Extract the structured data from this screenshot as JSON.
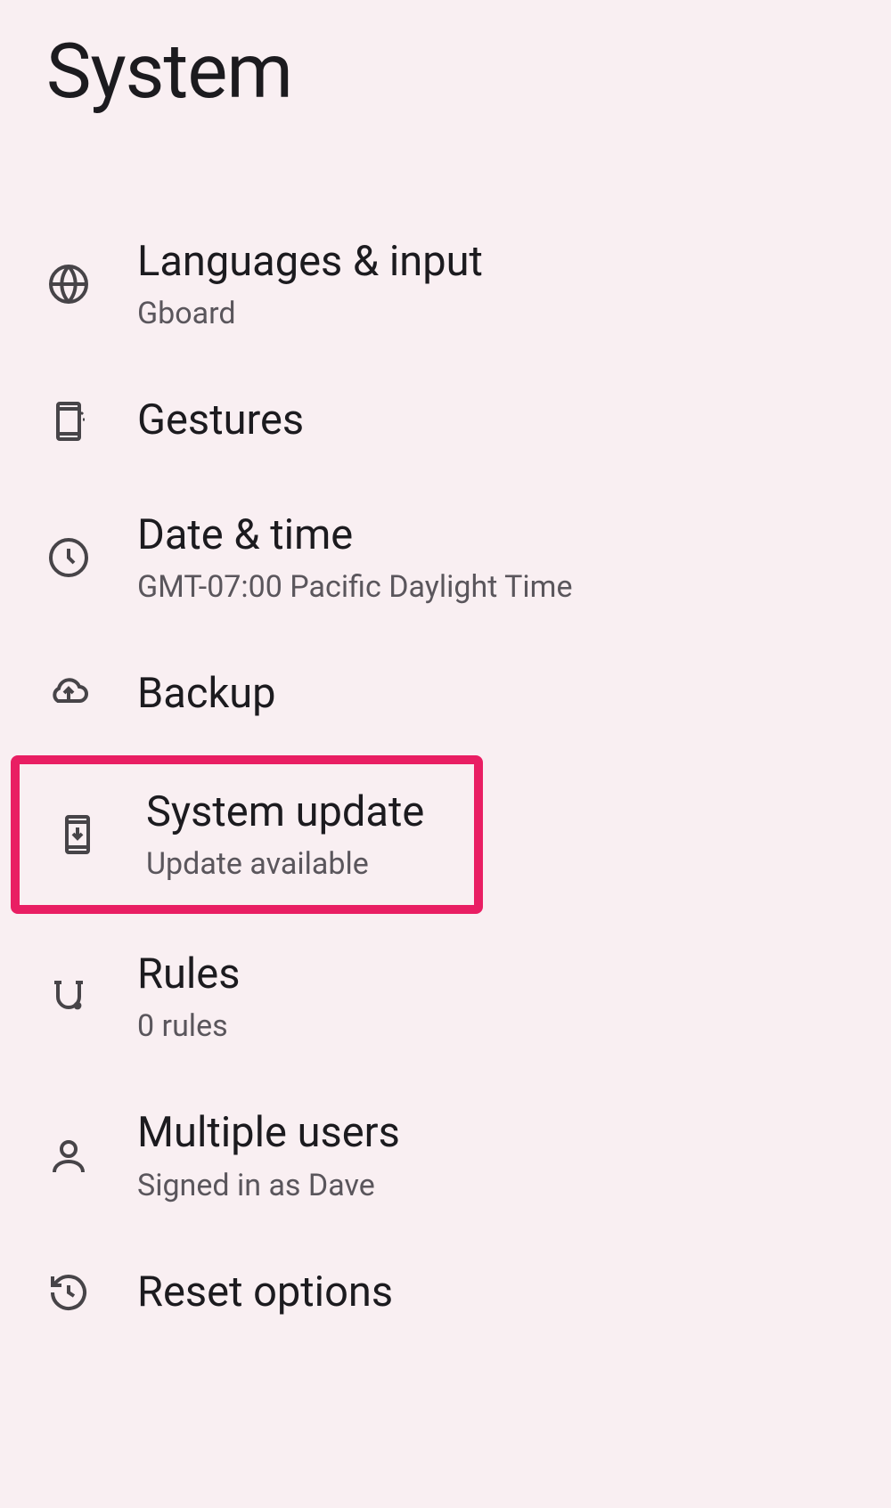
{
  "header": {
    "title": "System"
  },
  "items": {
    "languages": {
      "title": "Languages & input",
      "sub": "Gboard"
    },
    "gestures": {
      "title": "Gestures",
      "sub": ""
    },
    "datetime": {
      "title": "Date & time",
      "sub": "GMT-07:00 Pacific Daylight Time"
    },
    "backup": {
      "title": "Backup",
      "sub": ""
    },
    "sysupdate": {
      "title": "System update",
      "sub": "Update available"
    },
    "rules": {
      "title": "Rules",
      "sub": "0 rules"
    },
    "users": {
      "title": "Multiple users",
      "sub": "Signed in as Dave"
    },
    "reset": {
      "title": "Reset options",
      "sub": ""
    }
  }
}
